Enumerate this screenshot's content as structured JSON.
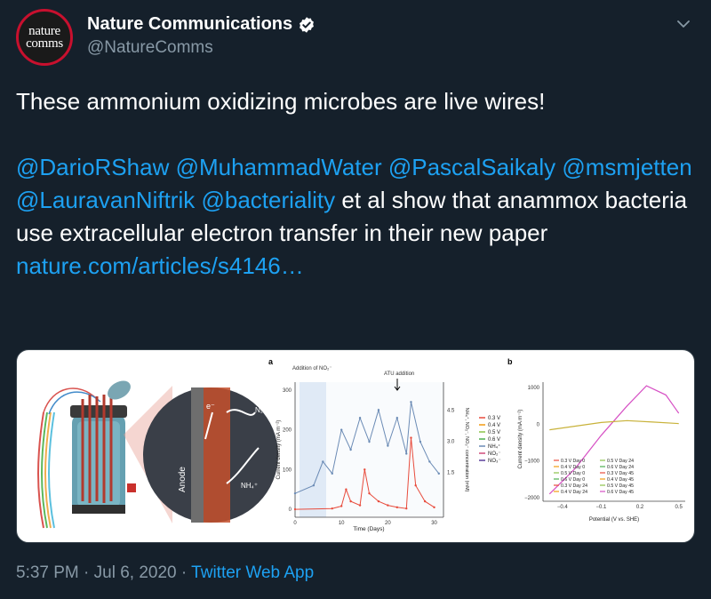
{
  "profile": {
    "avatar_line1": "nature",
    "avatar_line2": "comms",
    "display_name": "Nature Communications",
    "handle": "@NatureComms"
  },
  "tweet": {
    "text1": "These ammonium oxidizing microbes are live wires!",
    "mentions": [
      "@DarioRShaw",
      "@MuhammadWater",
      "@PascalSaikaly",
      "@msmjetten",
      "@LauravanNiftrik",
      "@bacteriality"
    ],
    "text2": " et al show that anammox bacteria use extracellular electron transfer in their new paper",
    "link": "nature.com/articles/s4146…"
  },
  "footer": {
    "time": "5:37 PM",
    "sep1": " · ",
    "date": "Jul 6, 2020",
    "sep2": " · ",
    "app": "Twitter Web App"
  },
  "figure": {
    "panel_a": "a",
    "panel_b": "b",
    "illustration": {
      "anode_label": "Anode",
      "electron_label": "e⁻",
      "n2_label": "N₂",
      "nh4_label": "NH₄⁺"
    },
    "annotation_no2": "Addition of NO₂⁻",
    "annotation_atu": "ATU addition"
  },
  "chart_data": [
    {
      "type": "line",
      "panel": "a",
      "xlabel": "Time (Days)",
      "ylabel": "Current density (mA m⁻²)",
      "y2label": "NH₄⁺, NO₂⁻, NO₃⁻ concentration (mM)",
      "x_ticks": [
        "0",
        "10",
        "20",
        "30"
      ],
      "y_ticks": [
        "0",
        "100",
        "200",
        "300"
      ],
      "y2_ticks": [
        "1.5",
        "3.0",
        "4.5"
      ],
      "xlim": [
        0,
        32
      ],
      "ylim": [
        -20,
        320
      ],
      "legend": [
        "0.3 V",
        "0.4 V",
        "0.5 V",
        "0.6 V",
        "NH₄⁺",
        "NO₂⁻",
        "NO₃⁻"
      ],
      "colors": [
        "#e84c3d",
        "#f39c12",
        "#8bc34a",
        "#4caf50",
        "#6b8bb5",
        "#d04a7a",
        "#5a3f9a"
      ],
      "series": [
        {
          "name": "0.3 V",
          "x": [
            0,
            8,
            10,
            11,
            12,
            14,
            15,
            16,
            18,
            20,
            22,
            24,
            25,
            26,
            28,
            30
          ],
          "y": [
            0,
            2,
            8,
            50,
            20,
            10,
            100,
            40,
            20,
            10,
            5,
            2,
            180,
            60,
            20,
            5
          ]
        },
        {
          "name": "NH₄⁺",
          "x": [
            0,
            4,
            6,
            8,
            10,
            12,
            14,
            16,
            18,
            20,
            22,
            24,
            25,
            27,
            29,
            31
          ],
          "y": [
            40,
            60,
            120,
            90,
            200,
            150,
            230,
            170,
            250,
            160,
            230,
            140,
            270,
            170,
            120,
            90
          ]
        }
      ]
    },
    {
      "type": "line",
      "panel": "b",
      "xlabel": "Potential (V vs. SHE)",
      "ylabel": "Current density (mA m⁻²)",
      "x_ticks": [
        "−0.4",
        "−0.1",
        "0.2",
        "0.5"
      ],
      "y_ticks": [
        "1000",
        "0",
        "−1000",
        "−2000"
      ],
      "xlim": [
        -0.55,
        0.55
      ],
      "ylim": [
        -2100,
        1150
      ],
      "legend": [
        "0.3 V Day 0",
        "0.4 V Day 0",
        "0.5 V Day 0",
        "0.6 V Day 0",
        "0.3 V Day 24",
        "0.4 V Day 24",
        "0.5 V Day 24",
        "0.6 V Day 24",
        "0.3 V Day 45",
        "0.4 V Day 45",
        "0.5 V Day 45",
        "0.6 V Day 45"
      ],
      "series": [
        {
          "name": "0.6 V Day 45",
          "x": [
            -0.5,
            -0.3,
            -0.1,
            0.1,
            0.25,
            0.4,
            0.5
          ],
          "y": [
            -1900,
            -1200,
            -300,
            500,
            1050,
            800,
            300
          ]
        },
        {
          "name": "0.3 V Day 0",
          "x": [
            -0.5,
            -0.3,
            -0.1,
            0.1,
            0.3,
            0.5
          ],
          "y": [
            -150,
            -50,
            50,
            100,
            60,
            20
          ]
        }
      ]
    }
  ]
}
